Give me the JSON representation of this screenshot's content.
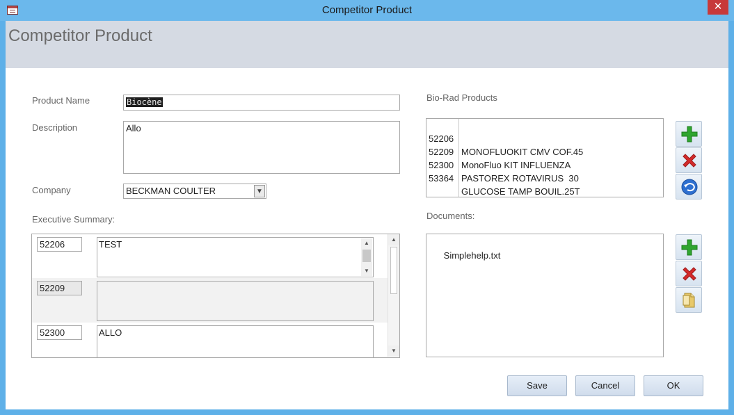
{
  "window": {
    "title": "Competitor Product",
    "close_glyph": "✕"
  },
  "form": {
    "title": "Competitor Product"
  },
  "fields": {
    "product_name_label": "Product Name",
    "product_name_value": "Biocène",
    "description_label": "Description",
    "description_value": "Allo",
    "company_label": "Company",
    "company_value": "BECKMAN COULTER",
    "exec_summary_label": "Executive Summary:"
  },
  "exec_summary": {
    "rows": [
      {
        "id": "52206",
        "text": "TEST"
      },
      {
        "id": "52209",
        "text": ""
      },
      {
        "id": "52300",
        "text": "ALLO"
      }
    ]
  },
  "biorad": {
    "label": "Bio-Rad Products",
    "items": [
      {
        "code": "52206",
        "name": "MONOFLUOKIT CMV COF.45"
      },
      {
        "code": "52209",
        "name": "MonoFluo KIT INFLUENZA"
      },
      {
        "code": "52300",
        "name": "PASTOREX ROTAVIRUS  30"
      },
      {
        "code": "53364",
        "name": "GLUCOSE TAMP BOUIL.25T"
      }
    ]
  },
  "documents": {
    "label": "Documents:",
    "items": [
      "Simplehelp.txt"
    ]
  },
  "buttons": {
    "save": "Save",
    "cancel": "Cancel",
    "ok": "OK"
  },
  "colors": {
    "title_bar": "#6bb8ec",
    "header_band": "#d5dae3",
    "add_icon": "#2fa52f",
    "delete_icon": "#d42a2a",
    "undo_icon": "#2d6fd0",
    "doc_icon": "#e8c96a"
  }
}
